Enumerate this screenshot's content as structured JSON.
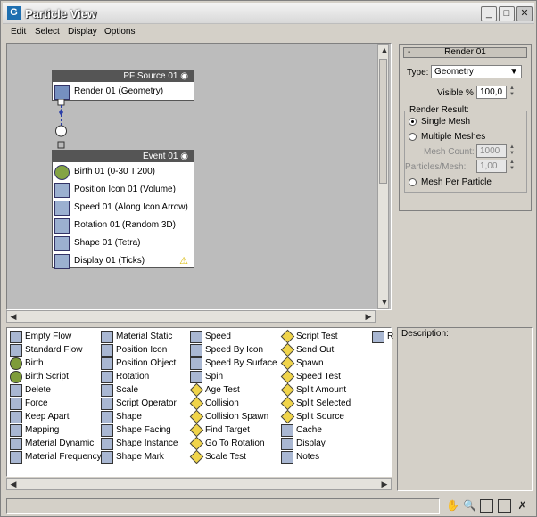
{
  "window": {
    "title": "Particle View",
    "app_icon": "3ds-max-icon"
  },
  "menubar": [
    "Edit",
    "Select",
    "Display",
    "Options"
  ],
  "source_node": {
    "title": "PF Source 01",
    "operators": [
      {
        "label": "Render 01 (Geometry)",
        "icon": "render-icon"
      }
    ]
  },
  "event_node": {
    "title": "Event 01",
    "operators": [
      {
        "label": "Birth 01 (0-30 T:200)",
        "icon": "birth-icon"
      },
      {
        "label": "Position Icon 01 (Volume)",
        "icon": "position-icon"
      },
      {
        "label": "Speed 01 (Along Icon Arrow)",
        "icon": "speed-icon"
      },
      {
        "label": "Rotation 01 (Random 3D)",
        "icon": "rotation-icon"
      },
      {
        "label": "Shape 01 (Tetra)",
        "icon": "shape-icon"
      },
      {
        "label": "Display 01 (Ticks)",
        "icon": "display-icon"
      }
    ]
  },
  "render_rollout": {
    "title": "Render 01",
    "type_label": "Type:",
    "type_value": "Geometry",
    "visible_label": "Visible %",
    "visible_value": "100,0",
    "group_label": "Render Result:",
    "single_mesh": "Single Mesh",
    "multiple_meshes": "Multiple Meshes",
    "mesh_count_label": "Mesh Count:",
    "mesh_count_value": "1000",
    "particles_mesh_label": "Particles/Mesh:",
    "particles_mesh_value": "1,00",
    "mesh_per_particle": "Mesh Per Particle"
  },
  "description_label": "Description:",
  "depot_extra_label": "R",
  "depot": {
    "col1": [
      "Empty Flow",
      "Standard Flow",
      "Birth",
      "Birth Script",
      "Delete",
      "Force",
      "Keep Apart",
      "Mapping",
      "Material Dynamic",
      "Material Frequency"
    ],
    "col2": [
      "Material Static",
      "Position Icon",
      "Position Object",
      "Rotation",
      "Scale",
      "Script Operator",
      "Shape",
      "Shape Facing",
      "Shape Instance",
      "Shape Mark"
    ],
    "col3": [
      "Speed",
      "Speed By Icon",
      "Speed By Surface",
      "Spin",
      "Age Test",
      "Collision",
      "Collision Spawn",
      "Find Target",
      "Go To Rotation",
      "Scale Test"
    ],
    "col4": [
      "Script Test",
      "Send Out",
      "Spawn",
      "Speed Test",
      "Split Amount",
      "Split Selected",
      "Split Source",
      "Cache",
      "Display",
      "Notes"
    ]
  },
  "status_tools": [
    "pan-icon",
    "zoom-icon",
    "zoom-region-icon",
    "zoom-extents-icon",
    "no-zoom-icon"
  ]
}
